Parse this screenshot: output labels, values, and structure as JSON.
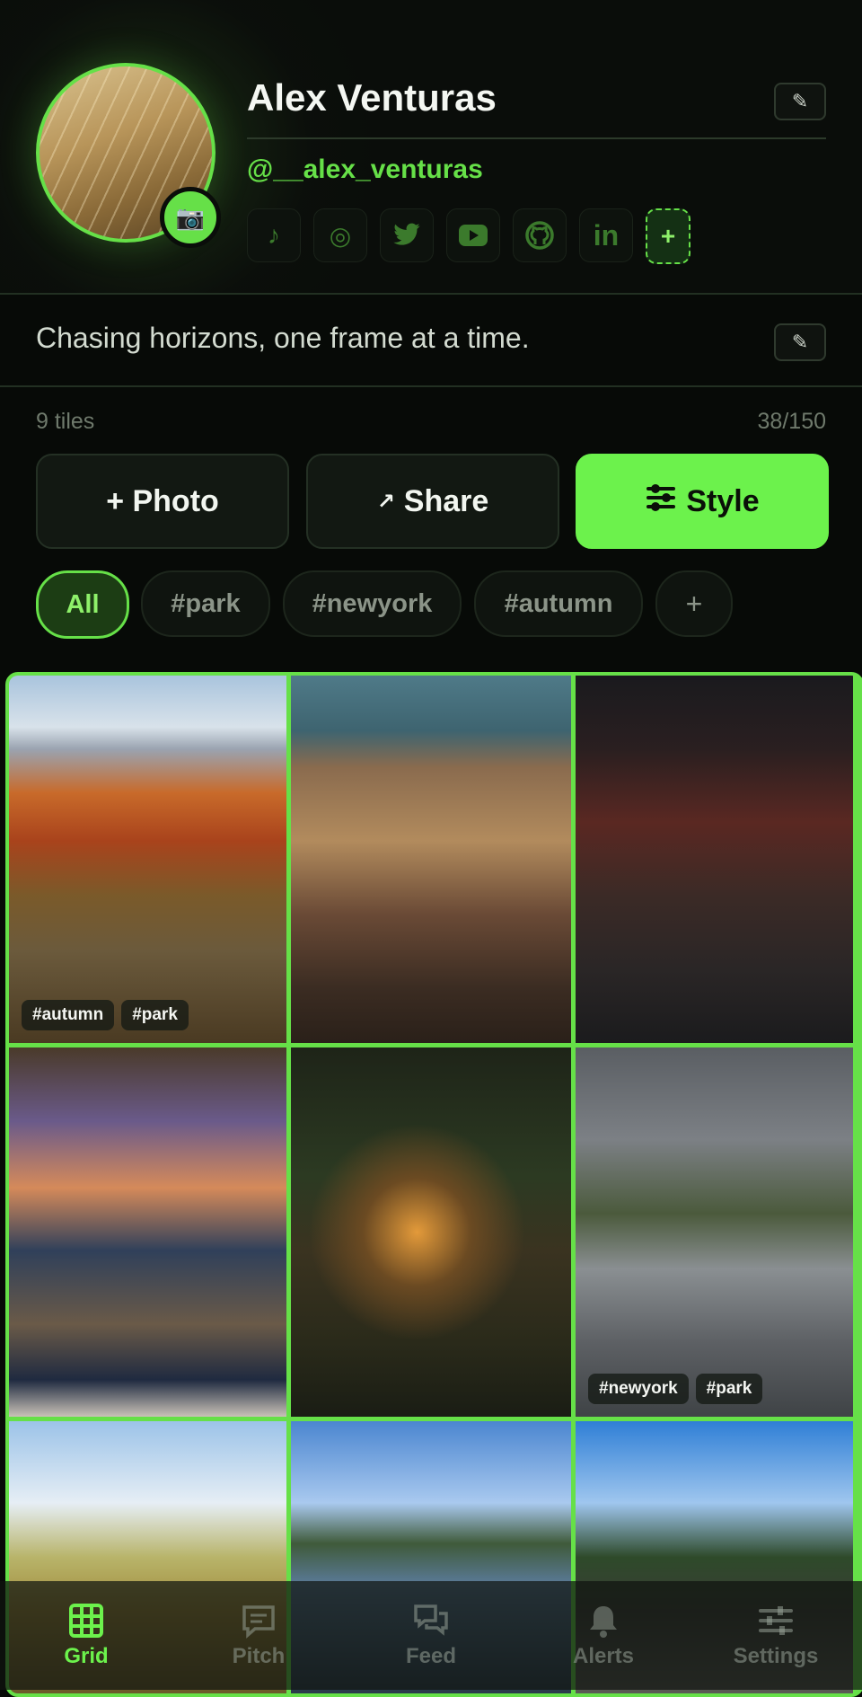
{
  "profile": {
    "name": "Alex Venturas",
    "handle": "@__alex_venturas",
    "bio": "Chasing horizons, one frame at a time.",
    "socials": [
      "tiktok-icon",
      "instagram-icon",
      "twitter-icon",
      "youtube-icon",
      "github-icon",
      "linkedin-icon"
    ],
    "socials_glyph": [
      "♪",
      "◎",
      "🐦",
      "▶",
      "◉",
      "in"
    ],
    "add_social": "+"
  },
  "stats": {
    "tiles": "9 tiles",
    "capacity": "38/150"
  },
  "actions": {
    "photo": "+ Photo",
    "share": "Share",
    "share_prefix": "↗",
    "style": "Style"
  },
  "filters": [
    "All",
    "#park",
    "#newyork",
    "#autumn",
    "+"
  ],
  "tiles": [
    {
      "tags": [
        "#autumn",
        "#park"
      ]
    },
    {
      "tags": []
    },
    {
      "tags": []
    },
    {
      "tags": []
    },
    {
      "tags": []
    },
    {
      "tags": [
        "#newyork",
        "#park"
      ]
    },
    {
      "tags": []
    },
    {
      "tags": []
    },
    {
      "tags": []
    }
  ],
  "nav": {
    "grid": "Grid",
    "pitch": "Pitch",
    "feed": "Feed",
    "alerts": "Alerts",
    "settings": "Settings"
  },
  "colors": {
    "accent": "#66e048",
    "background": "#070a07"
  }
}
